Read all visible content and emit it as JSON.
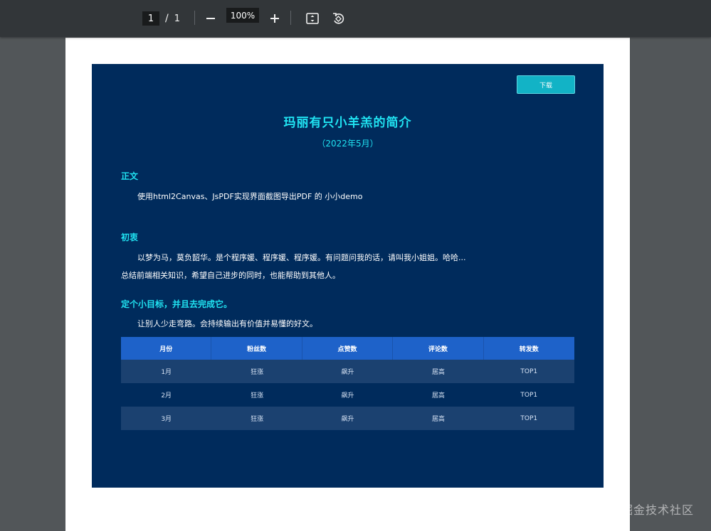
{
  "toolbar": {
    "current_page": "1",
    "page_separator": "/",
    "total_pages": "1",
    "zoom_level": "100%"
  },
  "document": {
    "download_label": "下载",
    "title": "玛丽有只小羊羔的简介",
    "subtitle": "（2022年5月）",
    "sections": [
      {
        "heading": "正文",
        "lines": [
          "使用html2Canvas、JsPDF实现界面截图导出PDF 的 小小demo"
        ]
      },
      {
        "heading": "初衷",
        "lines": [
          "以梦为马，莫负韶华。是个程序媛、程序媛、程序媛。有问题问我的话，请叫我小姐姐。哈哈...",
          "总结前端相关知识，希望自己进步的同时，也能帮助到其他人。"
        ]
      },
      {
        "heading": "定个小目标，并且去完成它。",
        "lines": [
          "让别人少走弯路。会持续输出有价值并易懂的好文。"
        ]
      }
    ],
    "table": {
      "headers": [
        "月份",
        "粉丝数",
        "点赞数",
        "评论数",
        "转发数"
      ],
      "rows": [
        [
          "1月",
          "狂涨",
          "飙升",
          "居高",
          "TOP1"
        ],
        [
          "2月",
          "狂涨",
          "飙升",
          "居高",
          "TOP1"
        ],
        [
          "3月",
          "狂涨",
          "飙升",
          "居高",
          "TOP1"
        ]
      ]
    }
  },
  "watermark": "@稀土掘金技术社区",
  "colors": {
    "viewer_bg": "#525659",
    "toolbar_bg": "#323639",
    "content_bg": "#002b5c",
    "accent_cyan": "#20e3f2",
    "download_btn": "#12b3c6",
    "table_header": "#1e62c9",
    "table_row_alt": "#1b4170"
  },
  "icons": {
    "zoom_out": "minus-icon",
    "zoom_in": "plus-icon",
    "fit_page": "fit-to-page-icon",
    "rotate": "rotate-icon"
  }
}
